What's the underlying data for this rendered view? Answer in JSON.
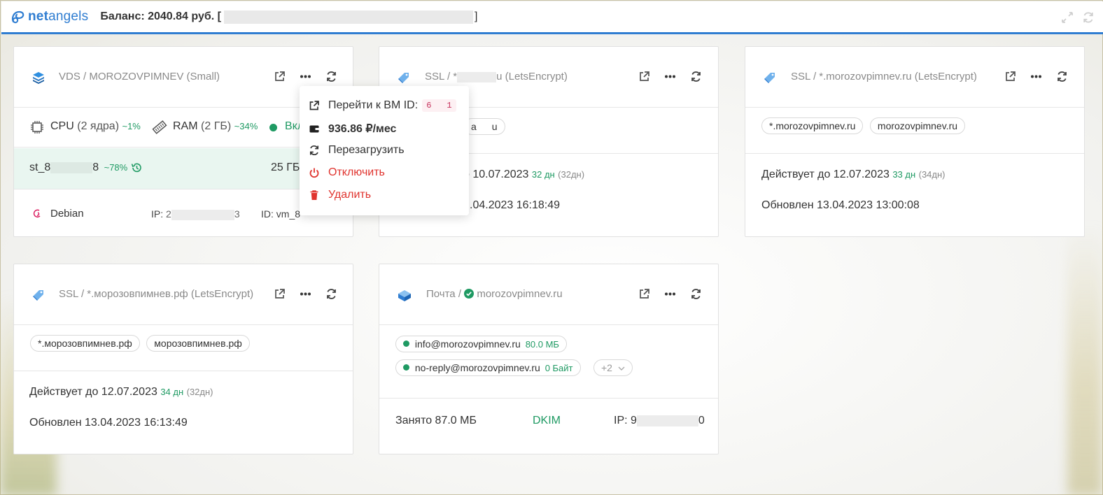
{
  "brand": {
    "logo_text_bold": "net",
    "logo_text_light": "angels"
  },
  "header": {
    "balance_label": "Баланс: 2040.84 руб. [",
    "balance_suffix": "]"
  },
  "cards": {
    "vds": {
      "title": "VDS / MOROZOVPIMNEV (Small)",
      "cpu_label": "CPU",
      "cpu_detail": "(2 ядра)",
      "cpu_usage": "~1%",
      "ram_label": "RAM",
      "ram_detail": "(2 ГБ)",
      "ram_usage": "~34%",
      "status_label": "Вкл",
      "storage_name_start": "st_8",
      "storage_name_end": "8",
      "storage_usage": "~78%",
      "storage_size": "25 ГБ",
      "os_name": "Debian",
      "ip_label": "IP:",
      "ip_start": "2",
      "ip_end": "3",
      "id_label": "ID:",
      "id_value": "vm_8"
    },
    "ssl1": {
      "title_start": "SSL / *",
      "title_end": "u (LetsEncrypt)",
      "chip_start": "a",
      "chip_end": "u",
      "valid_text": "о 10.07.2023",
      "valid_days": "32 дн",
      "valid_days_total": "(32дн)",
      "updated_text": ".04.2023 16:18:49"
    },
    "ssl2": {
      "title": "SSL / *.morozovpimnev.ru (LetsEncrypt)",
      "chips": [
        "*.morozovpimnev.ru",
        "morozovpimnev.ru"
      ],
      "valid_text": "Действует до 12.07.2023",
      "valid_days": "33 дн",
      "valid_days_total": "(34дн)",
      "updated_text": "Обновлен 13.04.2023 13:00:08"
    },
    "ssl3": {
      "title": "SSL / *.морозовпимнев.рф (LetsEncrypt)",
      "chips": [
        "*.морозовпимнев.рф",
        "морозовпимнев.рф"
      ],
      "valid_text": "Действует до 12.07.2023",
      "valid_days": "34 дн",
      "valid_days_total": "(32дн)",
      "updated_text": "Обновлен 13.04.2023 16:13:49"
    },
    "mail": {
      "title_prefix": "Почта /",
      "title_domain": "morozovpimnev.ru",
      "boxes": [
        {
          "address": "info@morozovpimnev.ru",
          "size": "80.0 МБ"
        },
        {
          "address": "no-reply@morozovpimnev.ru",
          "size": "0 Байт"
        }
      ],
      "more_label": "+2",
      "used_text": "Занято 87.0 МБ",
      "dkim_label": "DKIM",
      "ip_label": "IP: 9",
      "ip_end": "0"
    }
  },
  "menu": {
    "goto_label": "Перейти к ВМ ID:",
    "vm_id_start": "6",
    "vm_id_end": "1",
    "price": "936.86 ₽/мес",
    "reboot": "Перезагрузить",
    "shutdown": "Отключить",
    "delete": "Удалить"
  },
  "colors": {
    "accent": "#2f7dd1",
    "green": "#1f9a63",
    "danger": "#e0342f"
  }
}
